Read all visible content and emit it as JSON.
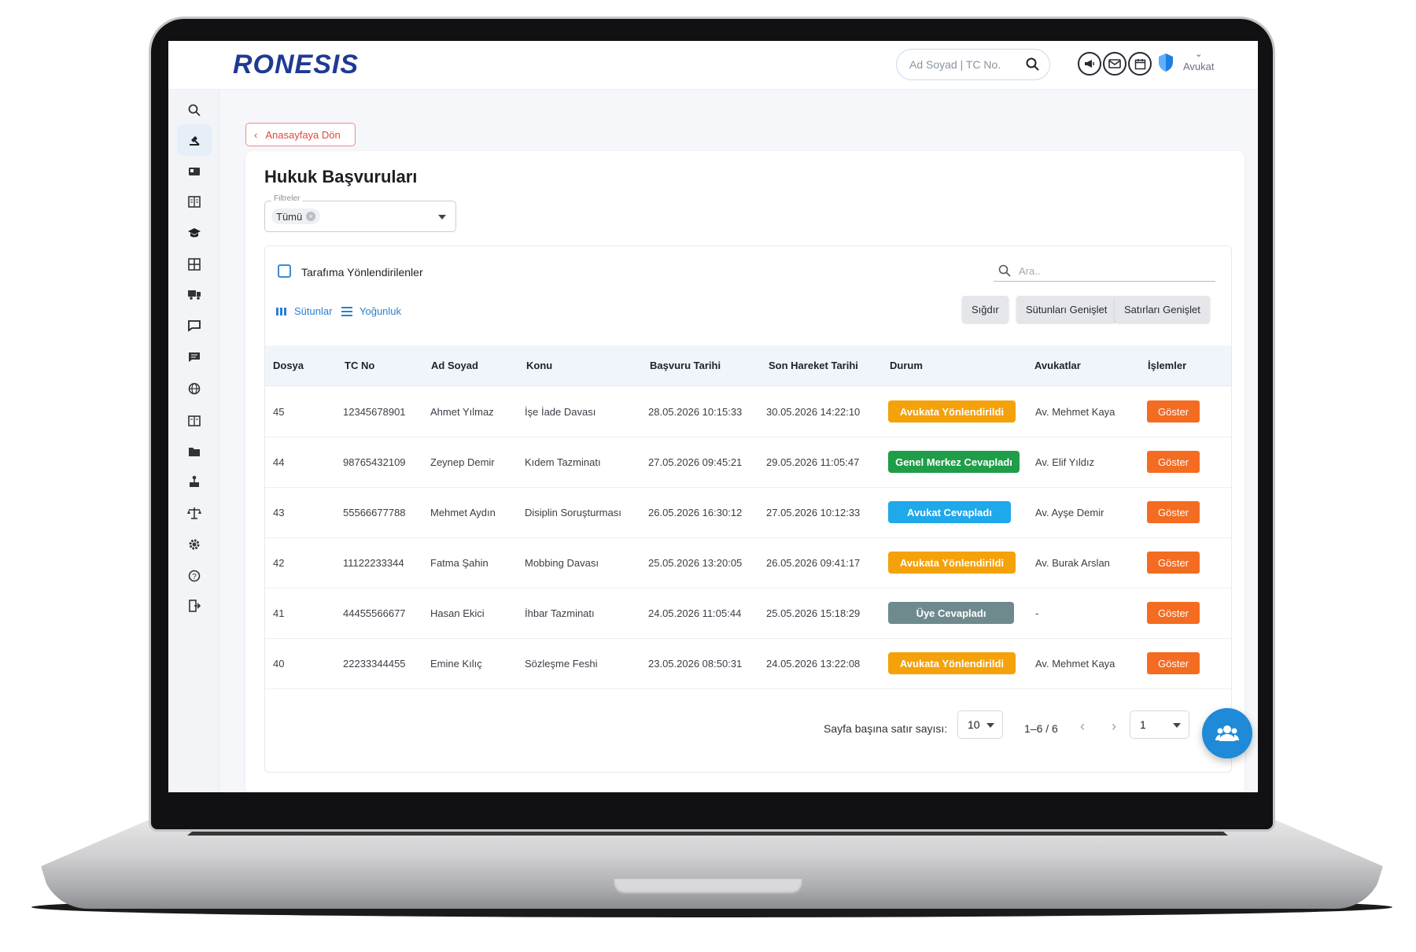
{
  "header": {
    "logo": "RONESIS",
    "search_placeholder": "Ad Soyad | TC No.",
    "user_role": "Avukat"
  },
  "nav": {
    "back_label": "Anasayfaya Dön"
  },
  "page": {
    "title": "Hukuk Başvuruları",
    "filter_label": "Filtreler",
    "filter_value": "Tümü"
  },
  "grid": {
    "checkbox_label": "Tarafıma Yönlendirilenler",
    "search_placeholder": "Ara..",
    "columns_btn": "Sütunlar",
    "density_btn": "Yoğunluk",
    "fit_btn": "Sığdır",
    "expand_cols_btn": "Sütunları Genişlet",
    "expand_rows_btn": "Satırları Genişlet",
    "headers": [
      "Dosya",
      "TC No",
      "Ad Soyad",
      "Konu",
      "Başvuru Tarihi",
      "Son Hareket Tarihi",
      "Durum",
      "Avukatlar",
      "İşlemler"
    ],
    "rows": [
      {
        "dosya": "45",
        "tc": "12345678901",
        "ad": "Ahmet Yılmaz",
        "konu": "İşe İade Davası",
        "basvuru": "28.05.2026 10:15:33",
        "son": "30.05.2026 14:22:10",
        "durum": "Avukata Yönlendirildi",
        "avukat": "Av. Mehmet Kaya",
        "islem": "Göster"
      },
      {
        "dosya": "44",
        "tc": "98765432109",
        "ad": "Zeynep Demir",
        "konu": "Kıdem Tazminatı",
        "basvuru": "27.05.2026 09:45:21",
        "son": "29.05.2026 11:05:47",
        "durum": "Genel Merkez Cevapladı",
        "avukat": "Av. Elif Yıldız",
        "islem": "Göster"
      },
      {
        "dosya": "43",
        "tc": "55566677788",
        "ad": "Mehmet Aydın",
        "konu": "Disiplin Soruşturması",
        "basvuru": "26.05.2026 16:30:12",
        "son": "27.05.2026 10:12:33",
        "durum": "Avukat Cevapladı",
        "avukat": "Av. Ayşe Demir",
        "islem": "Göster"
      },
      {
        "dosya": "42",
        "tc": "11122233344",
        "ad": "Fatma Şahin",
        "konu": "Mobbing Davası",
        "basvuru": "25.05.2026 13:20:05",
        "son": "26.05.2026 09:41:17",
        "durum": "Avukata Yönlendirildi",
        "avukat": "Av. Burak Arslan",
        "islem": "Göster"
      },
      {
        "dosya": "41",
        "tc": "44455566677",
        "ad": "Hasan Ekici",
        "konu": "İhbar Tazminatı",
        "basvuru": "24.05.2026 11:05:44",
        "son": "25.05.2026 15:18:29",
        "durum": "Üye Cevapladı",
        "avukat": "-",
        "islem": "Göster"
      },
      {
        "dosya": "40",
        "tc": "22233344455",
        "ad": "Emine Kılıç",
        "konu": "Sözleşme Feshi",
        "basvuru": "23.05.2026 08:50:31",
        "son": "24.05.2026 13:22:08",
        "durum": "Avukata Yönlendirildi",
        "avukat": "Av. Mehmet Kaya",
        "islem": "Göster"
      }
    ]
  },
  "pagination": {
    "rows_per_page_label": "Sayfa başına satır sayısı:",
    "rows_per_page": "10",
    "range": "1–6 / 6",
    "page": "1"
  },
  "colors": {
    "brand": "#1f3a93",
    "status_avukata_yonlendirildi": "#f5a10a",
    "status_genel_merkez_cevapladi": "#1f9d48",
    "status_avukat_cevapladi": "#1fa8ea",
    "status_uye_cevapladi": "#6f8a8c",
    "action_button": "#f36c21",
    "accent": "#1e8ad8"
  },
  "icons": {
    "sidebar": [
      "search-icon",
      "gavel-icon",
      "id-card-icon",
      "building-icon",
      "graduation-cap-icon",
      "grid-icon",
      "truck-icon",
      "message-icon",
      "feedback-icon",
      "globe-icon",
      "office-icon",
      "folder-icon",
      "hierarchy-icon",
      "scales-icon",
      "gear-icon",
      "help-icon",
      "logout-icon"
    ]
  }
}
